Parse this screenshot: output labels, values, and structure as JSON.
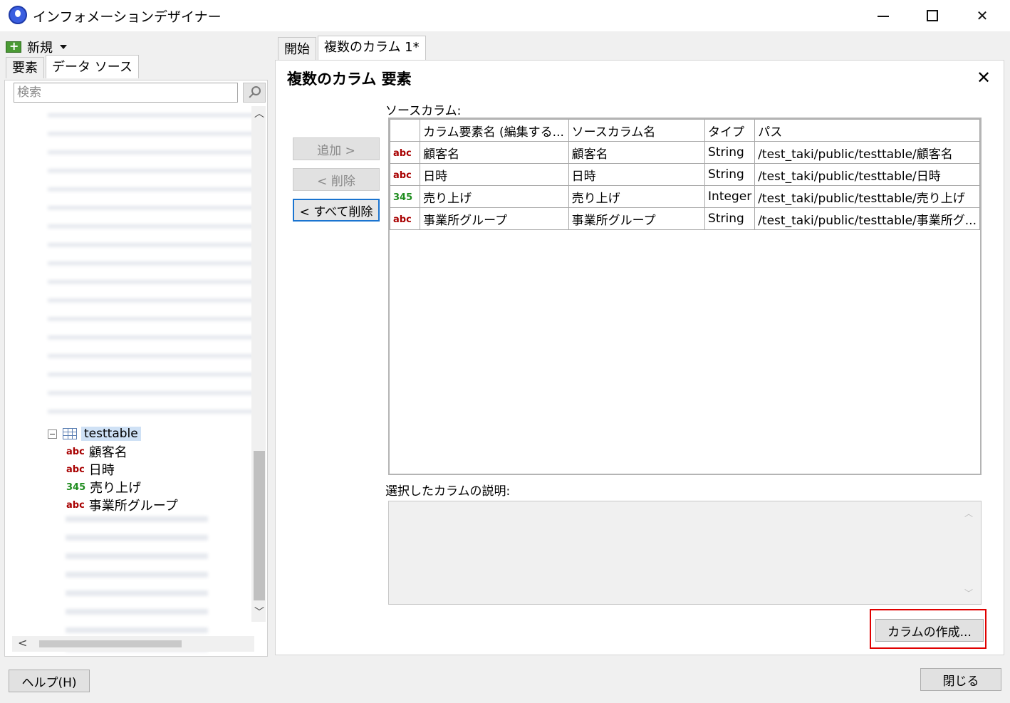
{
  "window": {
    "title": "インフォメーションデザイナー"
  },
  "left": {
    "new_label": "新規",
    "tabs": [
      "要素",
      "データ ソース"
    ],
    "search_placeholder": "検索",
    "tree": {
      "table_node": "testtable",
      "children": [
        {
          "type": "abc",
          "label": "顧客名"
        },
        {
          "type": "abc",
          "label": "日時"
        },
        {
          "type": "345",
          "label": "売り上げ"
        },
        {
          "type": "abc",
          "label": "事業所グループ"
        }
      ]
    }
  },
  "tabs": [
    "開始",
    "複数のカラム 1*"
  ],
  "panel": {
    "title": "複数のカラム 要素",
    "add_label": "追加 >",
    "remove_label": "< 削除",
    "remove_all_label": "< すべて削除",
    "source_label": "ソースカラム:",
    "grid": {
      "headers": [
        "",
        "カラム要素名 (編集する...",
        "ソースカラム名",
        "タイプ",
        "パス"
      ],
      "rows": [
        {
          "icon": "abc",
          "name": "顧客名",
          "source": "顧客名",
          "type": "String",
          "path": "/test_taki/public/testtable/顧客名"
        },
        {
          "icon": "abc",
          "name": "日時",
          "source": "日時",
          "type": "String",
          "path": "/test_taki/public/testtable/日時"
        },
        {
          "icon": "345",
          "name": "売り上げ",
          "source": "売り上げ",
          "type": "Integer",
          "path": "/test_taki/public/testtable/売り上げ"
        },
        {
          "icon": "abc",
          "name": "事業所グループ",
          "source": "事業所グループ",
          "type": "String",
          "path": "/test_taki/public/testtable/事業所グ..."
        }
      ]
    },
    "desc_label": "選択したカラムの説明:",
    "create_label": "カラムの作成..."
  },
  "footer": {
    "help_label": "ヘルプ(H)",
    "close_label": "閉じる"
  },
  "colors": {
    "abc": "#a80000",
    "num": "#1e8c1e",
    "highlight": "#e00000",
    "primary_border": "#1a74d0"
  }
}
